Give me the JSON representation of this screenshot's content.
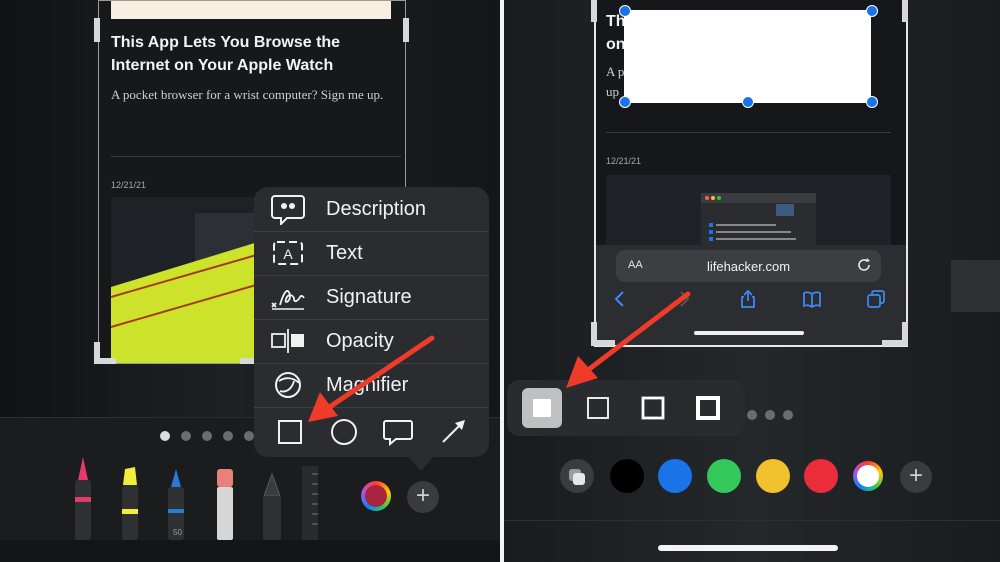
{
  "left": {
    "article": {
      "title": "This App Lets You Browse the Internet on Your Apple Watch",
      "subtitle": "A pocket browser for a wrist computer? Sign me up.",
      "date": "12/21/21"
    },
    "menu": {
      "items": [
        {
          "label": "Description",
          "icon": "quote-bubble-icon"
        },
        {
          "label": "Text",
          "icon": "text-box-icon"
        },
        {
          "label": "Signature",
          "icon": "signature-icon"
        },
        {
          "label": "Opacity",
          "icon": "opacity-icon"
        },
        {
          "label": "Magnifier",
          "icon": "magnifier-icon"
        }
      ],
      "shapes": [
        "square-shape-icon",
        "circle-shape-icon",
        "speech-bubble-shape-icon",
        "arrow-shape-icon"
      ]
    },
    "toolbar": {
      "pen_width": "50",
      "current_color": "#a8263d",
      "page_count": 5,
      "active_page": 1,
      "add_symbol": "+"
    }
  },
  "right": {
    "article": {
      "title_fragment": "Th\non",
      "subtitle_fragment": "A p\nup",
      "date": "12/21/21"
    },
    "safari": {
      "aa_label": "AA",
      "url": "lifehacker.com"
    },
    "border_styles": [
      "filled",
      "thin",
      "medium",
      "thick"
    ],
    "selected_border": "filled",
    "swatches": [
      "#000000",
      "#1a73e8",
      "#34c759",
      "#f2c12e",
      "#eb2d3a"
    ],
    "add_symbol": "+"
  },
  "arrow_color": "#ee3b2a"
}
